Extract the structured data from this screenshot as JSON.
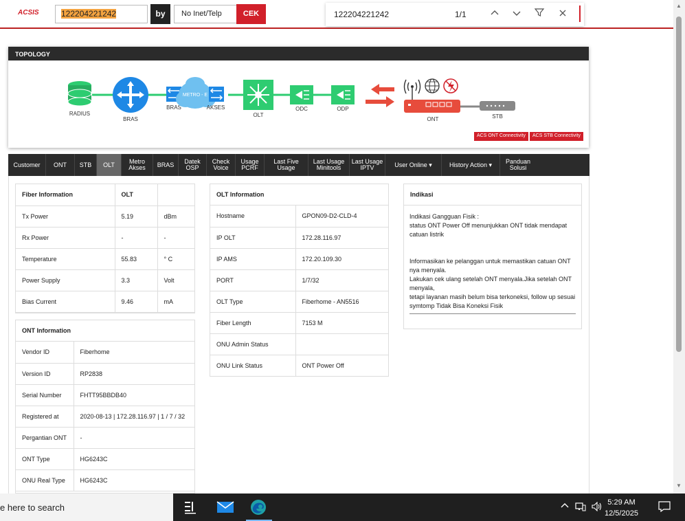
{
  "colors": {
    "brand": "#d1202a",
    "dark": "#2b2b2b",
    "link_green": "#2ecc71",
    "cloud": "#6fc0f0",
    "blue_node": "#1e88e5"
  },
  "topbar": {
    "logo": "ACSIS",
    "msisdn_value": "122204221242",
    "by_label": "by",
    "type_select": "No Inet/Telp",
    "cek_label": "CEK"
  },
  "findbar": {
    "query": "122204221242",
    "count": "1/1",
    "icons": [
      "chevron-up-icon",
      "chevron-down-icon",
      "filter-icon",
      "close-icon"
    ]
  },
  "topology": {
    "title": "TOPOLOGY",
    "nodes": {
      "radius": "RADIUS",
      "bras_router": "BRAS",
      "bras_switch": "BRAS",
      "metro": "METRO - E",
      "akses": "AKSES",
      "olt": "OLT",
      "odc": "ODC",
      "odp": "ODP",
      "ont": "ONT",
      "stb": "STB"
    },
    "buttons": {
      "acs_ont": "ACS ONT Connectivity",
      "acs_stb": "ACS STB Connectivity"
    }
  },
  "nav": {
    "items": [
      {
        "label": "Customer"
      },
      {
        "label": "ONT"
      },
      {
        "label": "STB"
      },
      {
        "label": "OLT",
        "active": true
      },
      {
        "label": "Metro\nAkses"
      },
      {
        "label": "BRAS"
      },
      {
        "label": "Datek\nOSP"
      },
      {
        "label": "Check\nVoice"
      },
      {
        "label": "Usage\nPCRF"
      },
      {
        "label": "Last Five\nUsage"
      },
      {
        "label": "Last Usage\nMinitools"
      },
      {
        "label": "Last Usage\nIPTV"
      },
      {
        "label": "User Online ▾"
      },
      {
        "label": "History Action ▾"
      },
      {
        "label": "Panduan\nSolusi"
      }
    ]
  },
  "fiber": {
    "header": [
      "Fiber Information",
      "OLT",
      ""
    ],
    "rows": [
      [
        "Tx Power",
        "5.19",
        "dBm"
      ],
      [
        "Rx Power",
        "-",
        "-"
      ],
      [
        "Temperature",
        "55.83",
        "° C"
      ],
      [
        "Power Supply",
        "3.3",
        "Volt"
      ],
      [
        "Bias Current",
        "9.46",
        "mA"
      ]
    ]
  },
  "ont_info": {
    "title": "ONT Information",
    "rows": [
      [
        "Vendor ID",
        "Fiberhome"
      ],
      [
        "Version ID",
        "RP2838"
      ],
      [
        "Serial Number",
        "FHTT95BBDB40"
      ],
      [
        "Registered at",
        "2020-08-13 | 172.28.116.97 | 1 / 7 / 32"
      ],
      [
        "Pergantian ONT",
        "-"
      ],
      [
        "ONT Type",
        "HG6243C"
      ],
      [
        "ONU Real Type",
        "HG6243C"
      ]
    ]
  },
  "olt_info": {
    "title": "OLT Information",
    "rows": [
      [
        "Hostname",
        "GPON09-D2-CLD-4"
      ],
      [
        "IP OLT",
        "172.28.116.97"
      ],
      [
        "IP AMS",
        "172.20.109.30"
      ],
      [
        "PORT",
        "1/7/32"
      ],
      [
        "OLT Type",
        "Fiberhome - AN5516"
      ],
      [
        "Fiber Length",
        "7153 M"
      ],
      [
        "ONU Admin Status",
        ""
      ],
      [
        "ONU Link Status",
        "ONT Power Off"
      ]
    ]
  },
  "indikasi": {
    "title": "Indikasi",
    "line1": "Indikasi Gangguan Fisik :",
    "line2": "status ONT Power Off menunjukkan ONT tidak mendapat catuan listrik",
    "line3": "Informasikan ke pelanggan untuk memastikan catuan ONT nya menyala.",
    "line4": "Lakukan cek ulang setelah ONT menyala.Jika setelah ONT menyala,",
    "line5": "tetapi layanan masih belum bisa terkoneksi, follow up sesuai symtomp Tidak Bisa Koneksi Fisik"
  },
  "taskbar": {
    "search_text": "e here to search",
    "time": "5:29 AM",
    "date": "12/5/2025"
  }
}
